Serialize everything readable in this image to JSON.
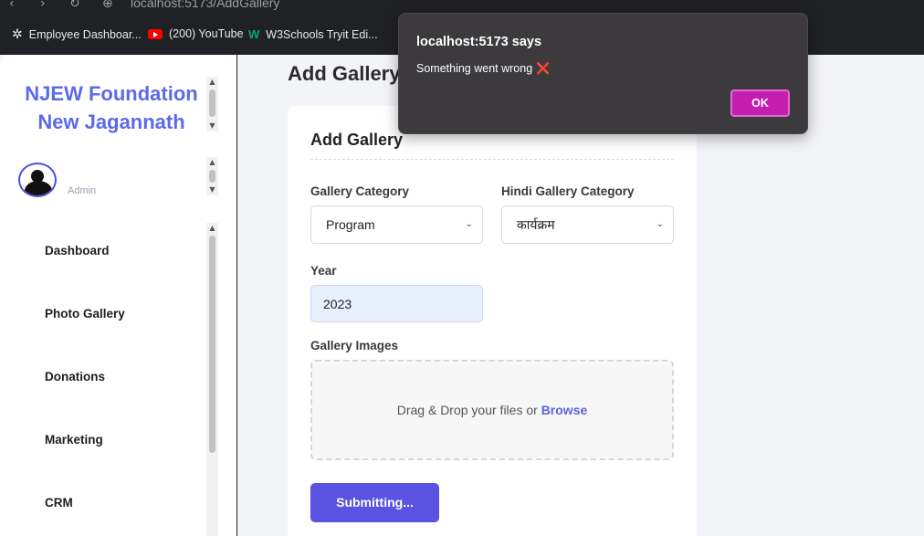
{
  "browser": {
    "url": "localhost:5173/AddGallery",
    "bookmarks": [
      {
        "label": "Employee Dashboar...",
        "icon": "openai-icon"
      },
      {
        "label": "(200) YouTube",
        "icon": "youtube-icon"
      },
      {
        "label": "W3Schools Tryit Edi...",
        "icon": "w3schools-icon"
      }
    ]
  },
  "sidebar": {
    "brand_line1": "NJEW Foundation",
    "brand_line2": "New Jagannath",
    "role": "Admin",
    "items": [
      {
        "label": "Dashboard"
      },
      {
        "label": "Photo Gallery"
      },
      {
        "label": "Donations"
      },
      {
        "label": "Marketing"
      },
      {
        "label": "CRM"
      }
    ]
  },
  "main": {
    "page_title": "Add Gallery",
    "card_title": "Add Gallery",
    "gallery_category_label": "Gallery Category",
    "gallery_category_value": "Program",
    "hindi_category_label": "Hindi Gallery Category",
    "hindi_category_value": "कार्यक्रम",
    "year_label": "Year",
    "year_value": "2023",
    "images_label": "Gallery Images",
    "dropzone_text": "Drag & Drop your files or ",
    "dropzone_browse": "Browse",
    "submit_label": "Submitting..."
  },
  "dialog": {
    "title": "localhost:5173 says",
    "message": "Something went wrong",
    "message_icon": "❌",
    "ok_label": "OK"
  },
  "colors": {
    "brand": "#5b6ae8",
    "submit": "#5a52e0",
    "dialog_ok": "#c51fb0",
    "dialog_bg": "#3c3a3d"
  }
}
